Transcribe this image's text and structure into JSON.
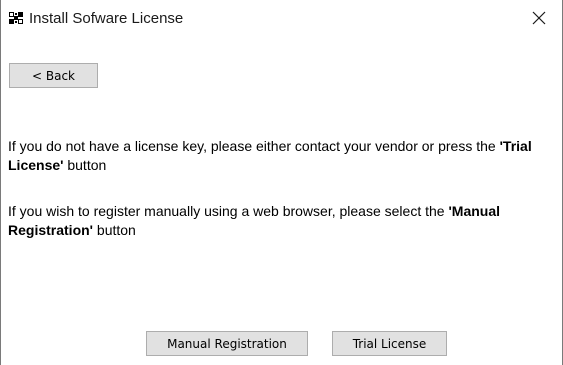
{
  "window": {
    "title": "Install Sofware License",
    "close_icon": "close-icon",
    "app_icon": "license-app-icon"
  },
  "nav": {
    "back_label": "< Back"
  },
  "message": {
    "para1_prefix": "If you do not have a license key, please either contact your vendor or press the ",
    "para1_bold": "'Trial License'",
    "para1_suffix": " button",
    "para2_prefix": "If you wish to register manually using a web browser, please select the ",
    "para2_bold": "'Manual Registration'",
    "para2_suffix": " button"
  },
  "actions": {
    "manual_label": "Manual Registration",
    "trial_label": "Trial License"
  },
  "colors": {
    "button_bg": "#e1e1e1",
    "button_border": "#adadad",
    "window_border": "#7a7a7a"
  }
}
